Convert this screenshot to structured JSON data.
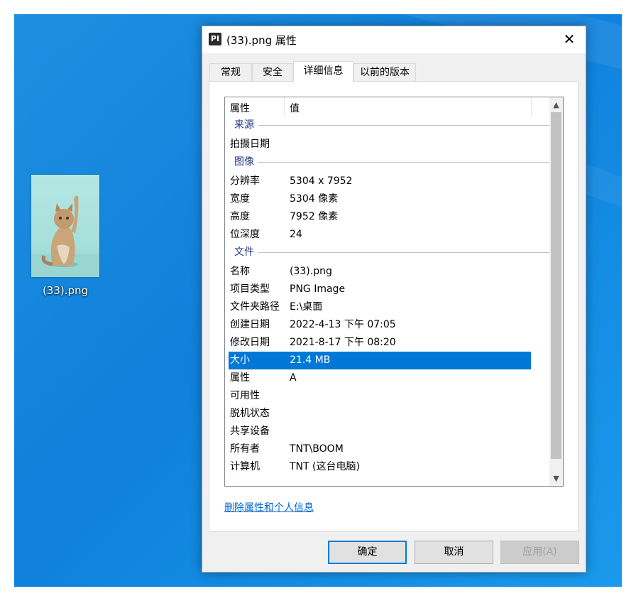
{
  "desktop": {
    "file_icon_label": "(33).png"
  },
  "dialog": {
    "title": "(33).png 属性",
    "app_icon_text": "PI",
    "close_glyph": "✕",
    "tabs": [
      "常规",
      "安全",
      "详细信息",
      "以前的版本"
    ],
    "active_tab": "详细信息",
    "columns": {
      "name": "属性",
      "value": "值"
    },
    "groups": {
      "source": "来源",
      "image": "图像",
      "file": "文件"
    },
    "source_rows": [
      {
        "key": "拍摄日期",
        "value": ""
      }
    ],
    "image_rows": [
      {
        "key": "分辨率",
        "value": "5304 x 7952"
      },
      {
        "key": "宽度",
        "value": "5304 像素"
      },
      {
        "key": "高度",
        "value": "7952 像素"
      },
      {
        "key": "位深度",
        "value": "24"
      }
    ],
    "file_rows": [
      {
        "key": "名称",
        "value": "(33).png"
      },
      {
        "key": "项目类型",
        "value": "PNG Image"
      },
      {
        "key": "文件夹路径",
        "value": "E:\\桌面"
      },
      {
        "key": "创建日期",
        "value": "2022-4-13 下午 07:05"
      },
      {
        "key": "修改日期",
        "value": "2021-8-17 下午 08:20"
      },
      {
        "key": "大小",
        "value": "21.4 MB"
      },
      {
        "key": "属性",
        "value": "A"
      },
      {
        "key": "可用性",
        "value": ""
      },
      {
        "key": "脱机状态",
        "value": ""
      },
      {
        "key": "共享设备",
        "value": ""
      },
      {
        "key": "所有者",
        "value": "TNT\\BOOM"
      },
      {
        "key": "计算机",
        "value": "TNT (这台电脑)"
      }
    ],
    "selected_row": "大小",
    "remove_link": "删除属性和个人信息",
    "buttons": {
      "ok": "确定",
      "cancel": "取消",
      "apply": "应用(A)"
    },
    "scroll_up_glyph": "▲",
    "scroll_down_glyph": "▼"
  },
  "colors": {
    "selection": "#0078d7",
    "link": "#0066cc",
    "desktop": "#0f80dc"
  }
}
